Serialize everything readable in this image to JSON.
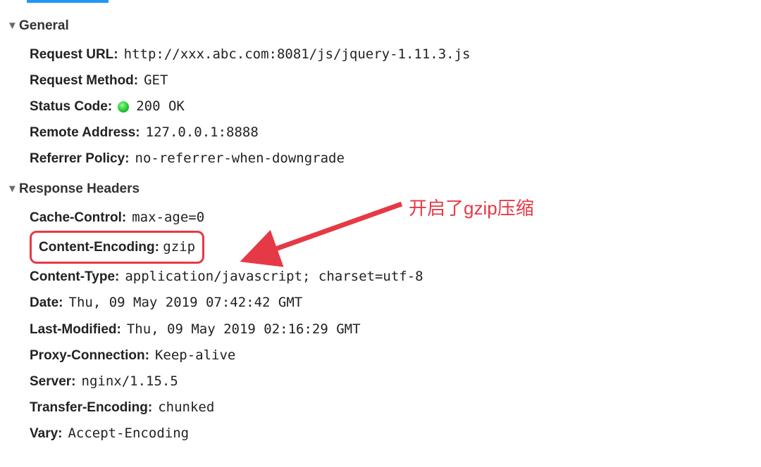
{
  "general": {
    "title": "General",
    "request_url_label": "Request URL:",
    "request_url_value": "http://xxx.abc.com:8081/js/jquery-1.11.3.js",
    "request_method_label": "Request Method:",
    "request_method_value": "GET",
    "status_code_label": "Status Code:",
    "status_code_value": "200 OK",
    "remote_address_label": "Remote Address:",
    "remote_address_value": "127.0.0.1:8888",
    "referrer_policy_label": "Referrer Policy:",
    "referrer_policy_value": "no-referrer-when-downgrade"
  },
  "response_headers": {
    "title": "Response Headers",
    "cache_control_label": "Cache-Control:",
    "cache_control_value": "max-age=0",
    "content_encoding_label": "Content-Encoding:",
    "content_encoding_value": "gzip",
    "content_type_label": "Content-Type:",
    "content_type_value": "application/javascript; charset=utf-8",
    "date_label": "Date:",
    "date_value": "Thu, 09 May 2019 07:42:42 GMT",
    "last_modified_label": "Last-Modified:",
    "last_modified_value": "Thu, 09 May 2019 02:16:29 GMT",
    "proxy_connection_label": "Proxy-Connection:",
    "proxy_connection_value": "Keep-alive",
    "server_label": "Server:",
    "server_value": "nginx/1.15.5",
    "transfer_encoding_label": "Transfer-Encoding:",
    "transfer_encoding_value": "chunked",
    "vary_label": "Vary:",
    "vary_value": "Accept-Encoding"
  },
  "annotation": {
    "text": "开启了gzip压缩"
  }
}
